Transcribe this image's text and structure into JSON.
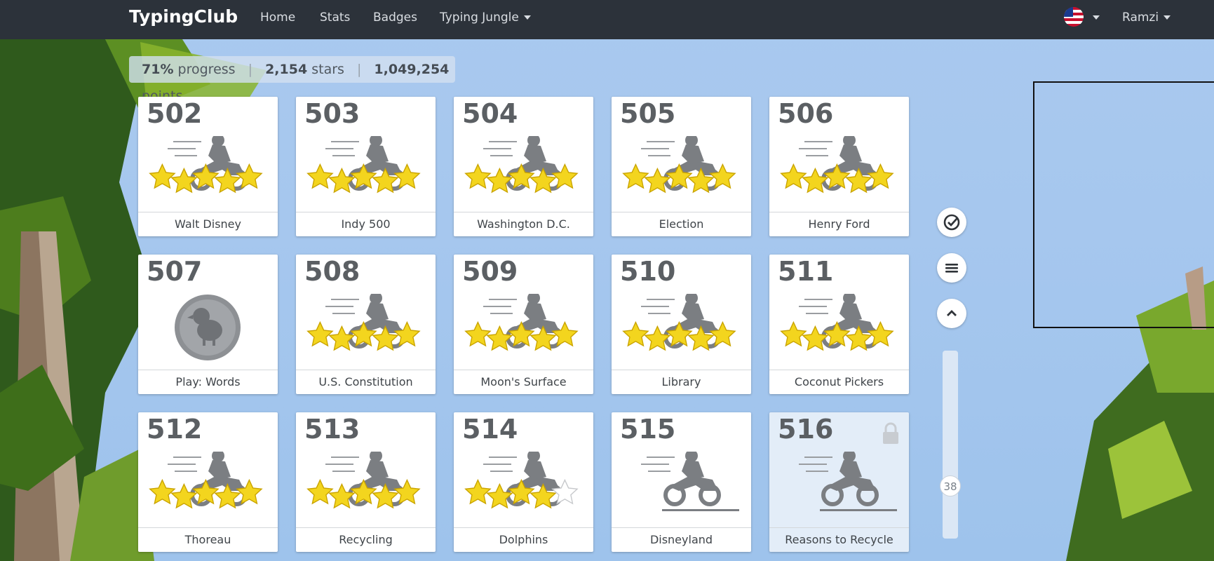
{
  "nav": {
    "brand": "TypingClub",
    "links": [
      "Home",
      "Stats",
      "Badges",
      "Typing Jungle"
    ],
    "flag_icon": "us-flag-icon",
    "user": "Ramzi"
  },
  "progress": {
    "percent": "71%",
    "percent_label": "progress",
    "stars": "2,154",
    "stars_label": "stars",
    "points": "1,049,254",
    "points_label": "points"
  },
  "lessons": [
    {
      "num": "502",
      "title": "Walt Disney",
      "stars": 5,
      "type": "race"
    },
    {
      "num": "503",
      "title": "Indy 500",
      "stars": 5,
      "type": "race"
    },
    {
      "num": "504",
      "title": "Washington D.C.",
      "stars": 5,
      "type": "race"
    },
    {
      "num": "505",
      "title": "Election",
      "stars": 5,
      "type": "race"
    },
    {
      "num": "506",
      "title": "Henry Ford",
      "stars": 5,
      "type": "race"
    },
    {
      "num": "507",
      "title": "Play: Words",
      "stars": 0,
      "type": "game"
    },
    {
      "num": "508",
      "title": "U.S. Constitution",
      "stars": 5,
      "type": "race"
    },
    {
      "num": "509",
      "title": "Moon's Surface",
      "stars": 5,
      "type": "race"
    },
    {
      "num": "510",
      "title": "Library",
      "stars": 5,
      "type": "race"
    },
    {
      "num": "511",
      "title": "Coconut Pickers",
      "stars": 5,
      "type": "race"
    },
    {
      "num": "512",
      "title": "Thoreau",
      "stars": 5,
      "type": "race"
    },
    {
      "num": "513",
      "title": "Recycling",
      "stars": 5,
      "type": "race"
    },
    {
      "num": "514",
      "title": "Dolphins",
      "stars": 4,
      "type": "race"
    },
    {
      "num": "515",
      "title": "Disneyland",
      "stars": 0,
      "type": "race"
    },
    {
      "num": "516",
      "title": "Reasons to Recycle",
      "stars": 0,
      "type": "race",
      "locked": true
    }
  ],
  "sidebar": {
    "check_icon": "check-circle-icon",
    "menu_icon": "menu-lines-icon",
    "up_icon": "chevron-up-icon",
    "scroll_value": "38"
  },
  "colors": {
    "nav_bg": "#2c323a",
    "star": "#f3d51e",
    "rider": "#7b7e82"
  }
}
